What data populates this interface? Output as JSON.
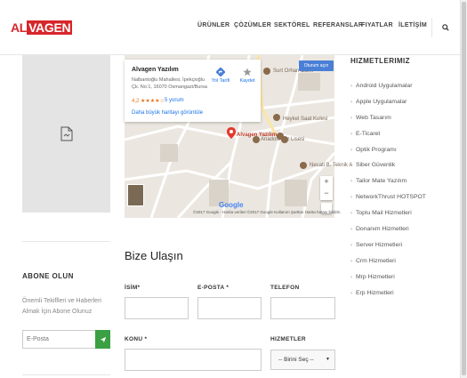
{
  "brand": {
    "logo_first": "AL",
    "logo_rest": "VAGEN",
    "accent": "#d7262b"
  },
  "nav": {
    "items": [
      {
        "label": "ÜRÜNLER"
      },
      {
        "label": "ÇÖZÜMLER"
      },
      {
        "label": "SEKTÖREL"
      },
      {
        "label": "REFERANSLAR"
      },
      {
        "label": "FIYATLAR"
      },
      {
        "label": "İLETİŞİM"
      }
    ],
    "search_icon": "search-icon"
  },
  "sidebar_left": {
    "image_icon": "broken-image-icon",
    "subscribe_title": "ABONE OLUN",
    "subscribe_text": "Önemli Tekiflleri ve Haberleri Almak İçin Abone Olunuz",
    "email_placeholder": "E-Posta",
    "send_icon": "send-icon",
    "button_color": "#3aa043"
  },
  "map": {
    "place_name": "Alvagen Yazılım",
    "address": "Nalbantoğlu Mahallesi, İpekçioğlu Çk. No:1, 16070 Osmangazi/Bursa",
    "rating": "4,2 ★★★★☆",
    "reviews": "5 yorum",
    "directions": "Yol Tarifi",
    "save": "Kaydet",
    "larger_map": "Daha büyük haritayı görüntüle",
    "sign_in": "Oturum açın",
    "marker_label": "Alvagen Yazılım",
    "labels": [
      "Surt Orhan Cami",
      "Heykel Saat Kulesi",
      "Anadolu Kız Lisesi",
      "Necati B. Teknik A"
    ],
    "footer": "©2017 Google - Harita verileri ©2017 Google   Kullanım Şartları   Harita hatası bildirin",
    "google": "Google"
  },
  "contact": {
    "title": "Bize Ulaşın",
    "name_label": "İSİM*",
    "email_label": "E-POSTA *",
    "phone_label": "TELEFON",
    "subject_label": "KONU *",
    "services_label": "HIZMETLER",
    "services_select": "-- Birini Seç --"
  },
  "services": {
    "title": "HIZMETLERIMIZ",
    "items": [
      "Android Uygulamalar",
      "Apple Uygulamalar",
      "Web Tasarım",
      "E-Ticaret",
      "Optik Programı",
      "Siber Güvenlik",
      "Tailor Mate Yazılım",
      "NetworkThrust HOTSPOT",
      "Toplu Mail Hizmetleri",
      "Donanım Hizmetleri",
      "Server Hizmetleri",
      "Crm Hizmetleri",
      "Mrp Hizmetleri",
      "Erp Hizmetleri"
    ]
  }
}
